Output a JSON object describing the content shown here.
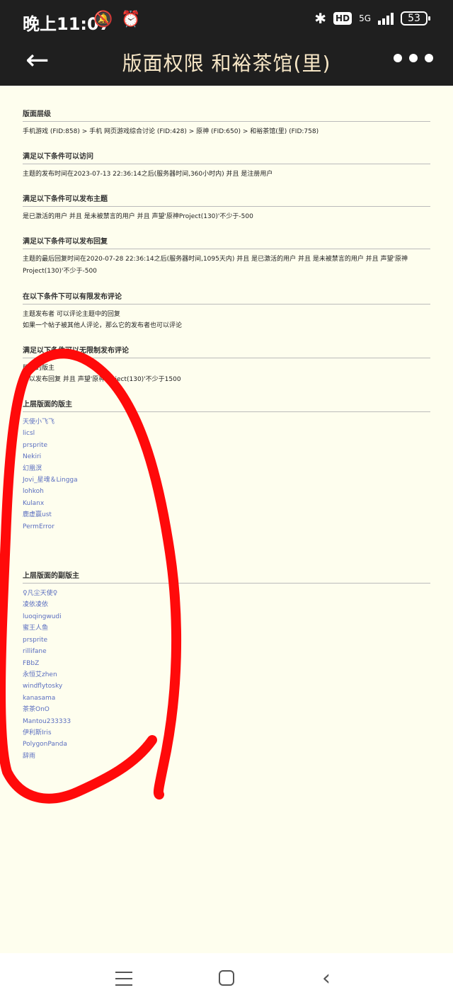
{
  "status_bar": {
    "time": "晚上11:07",
    "left_icons": [
      "mute-icon",
      "alarm-icon"
    ],
    "network_label": "5G",
    "hd_label": "HD",
    "battery": "53"
  },
  "title_bar": {
    "back_icon": "←",
    "title": "版面权限 和裕茶馆(里)",
    "more_icon": "more-icon"
  },
  "sections": {
    "hierarchy": {
      "title": "版面层级",
      "text": "手机游戏 (FID:858) > 手机 网页游戏综合讨论 (FID:428) > 原神 (FID:650) > 和裕茶馆(里) (FID:758)"
    },
    "visit": {
      "title": "满足以下条件可以访问",
      "text": "主题的发布时间在2023-07-13 22:36:14之后(服务器时间,360小时内) 并且 是注册用户"
    },
    "post_topic": {
      "title": "满足以下条件可以发布主题",
      "text": "是已激活的用户 并且 是未被禁言的用户 并且 声望'原神Project(130)'不少于-500"
    },
    "post_reply": {
      "title": "满足以下条件可以发布回复",
      "text": "主题的最后回复时间在2020-07-28 22:36:14之后(服务器时间,1095天内) 并且 是已激活的用户 并且 是未被禁言的用户 并且 声望'原神Project(130)'不少于-500"
    },
    "limited_comment": {
      "title": "在以下条件下可以有限发布评论",
      "lines": [
        "主题发布者 可以评论主题中的回复",
        "如果一个帖子被其他人评论，那么它的发布者也可以评论"
      ]
    },
    "unlimited_comment": {
      "title": "满足以下条件可以无限制发布评论",
      "lines": [
        "版内的版主",
        "可以发布回复 并且 声望'原神Project(130)'不少于1500"
      ]
    },
    "moderators": {
      "title": "上层版面的版主",
      "names": [
        "天使小飞飞",
        "licsl",
        "prsprite",
        "Nekiri",
        "幻凰溟",
        "Jovi_星魂＆Lingga",
        "lohkoh",
        "Kulanx",
        "鹿虚赢ust",
        "PermError"
      ]
    },
    "sub_moderators": {
      "title": "上层版面的副版主",
      "names": [
        "♀凡尘天使♀",
        "凌依凌依",
        "luoqingwudi",
        "蜜王人鱼",
        "prsprite",
        "rillifane",
        "FBbZ",
        "永恒艾zhen",
        "windflytosky",
        "kanasama",
        "茶茶OnO",
        "Mantou233333",
        "伊利斯Iris",
        "PolygonPanda",
        "辞雨"
      ]
    }
  },
  "annotation": {
    "color": "#ff0a0a",
    "shape": "hand-drawn-loop"
  },
  "nav_bar": {
    "items": [
      "menu-icon",
      "home-icon",
      "back-icon"
    ]
  }
}
